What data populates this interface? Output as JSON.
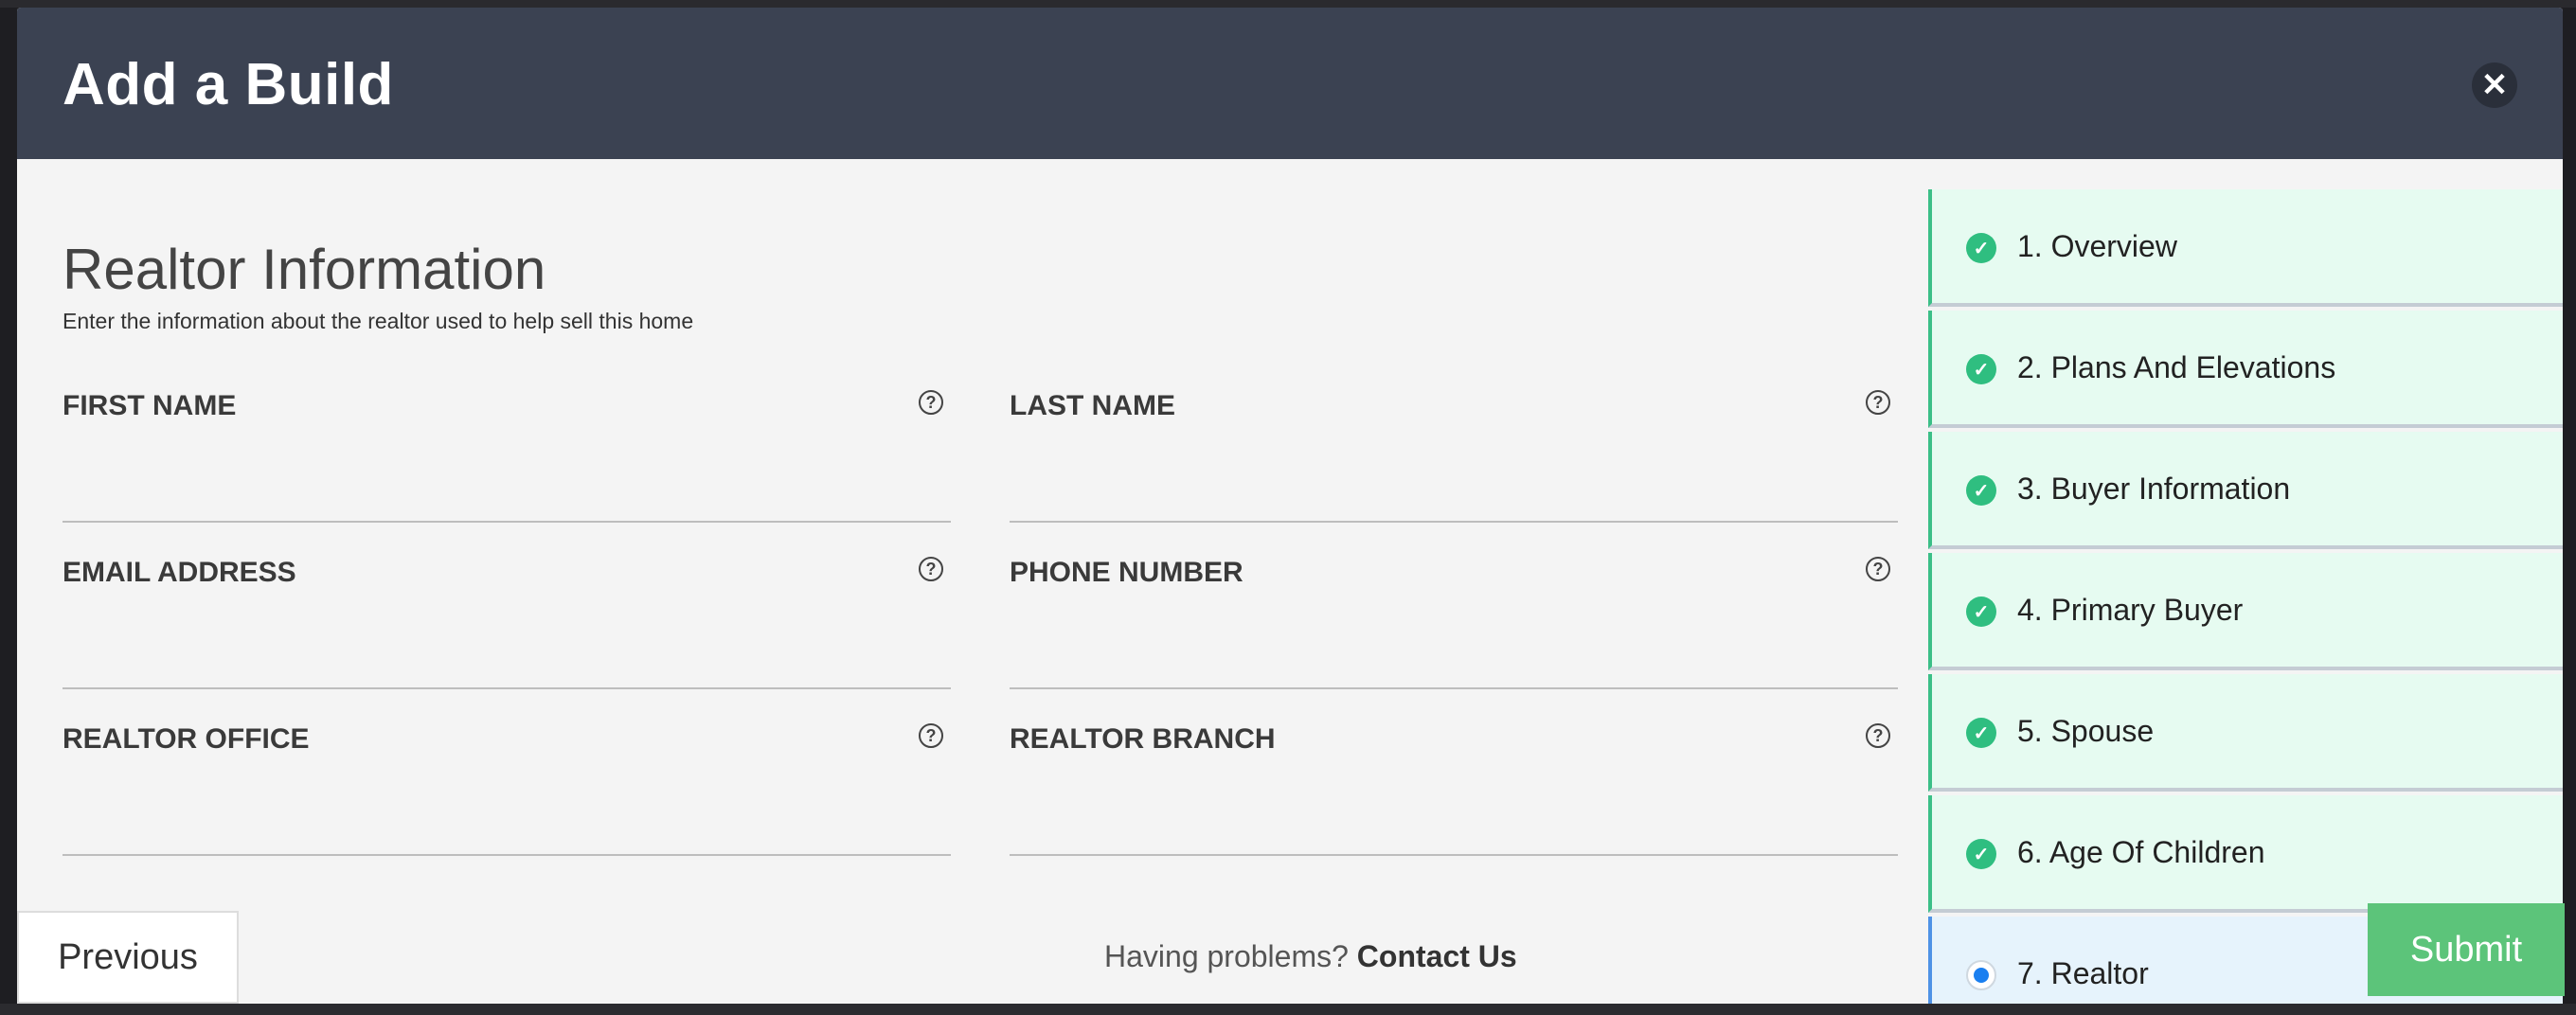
{
  "modal": {
    "title": "Add a Build",
    "close_icon": "close-icon"
  },
  "section": {
    "title": "Realtor Information",
    "subtitle": "Enter the information about the realtor used to help sell this home"
  },
  "fields": [
    {
      "label": "FIRST NAME",
      "value": ""
    },
    {
      "label": "LAST NAME",
      "value": ""
    },
    {
      "label": "EMAIL ADDRESS",
      "value": ""
    },
    {
      "label": "PHONE NUMBER",
      "value": ""
    },
    {
      "label": "REALTOR OFFICE",
      "value": ""
    },
    {
      "label": "REALTOR BRANCH",
      "value": ""
    }
  ],
  "footer": {
    "previous_label": "Previous",
    "help_text": "Having problems?",
    "contact_label": "Contact Us",
    "submit_label": "Submit"
  },
  "steps": [
    {
      "label": "1. Overview",
      "status": "complete"
    },
    {
      "label": "2. Plans And Elevations",
      "status": "complete"
    },
    {
      "label": "3. Buyer Information",
      "status": "complete"
    },
    {
      "label": "4. Primary Buyer",
      "status": "complete"
    },
    {
      "label": "5. Spouse",
      "status": "complete"
    },
    {
      "label": "6. Age Of Children",
      "status": "complete"
    },
    {
      "label": "7. Realtor",
      "status": "active"
    }
  ],
  "colors": {
    "header_bg": "#3b4252",
    "complete_green": "#2fbe80",
    "active_blue": "#1a7ff0",
    "submit_green": "#5cc47a"
  }
}
